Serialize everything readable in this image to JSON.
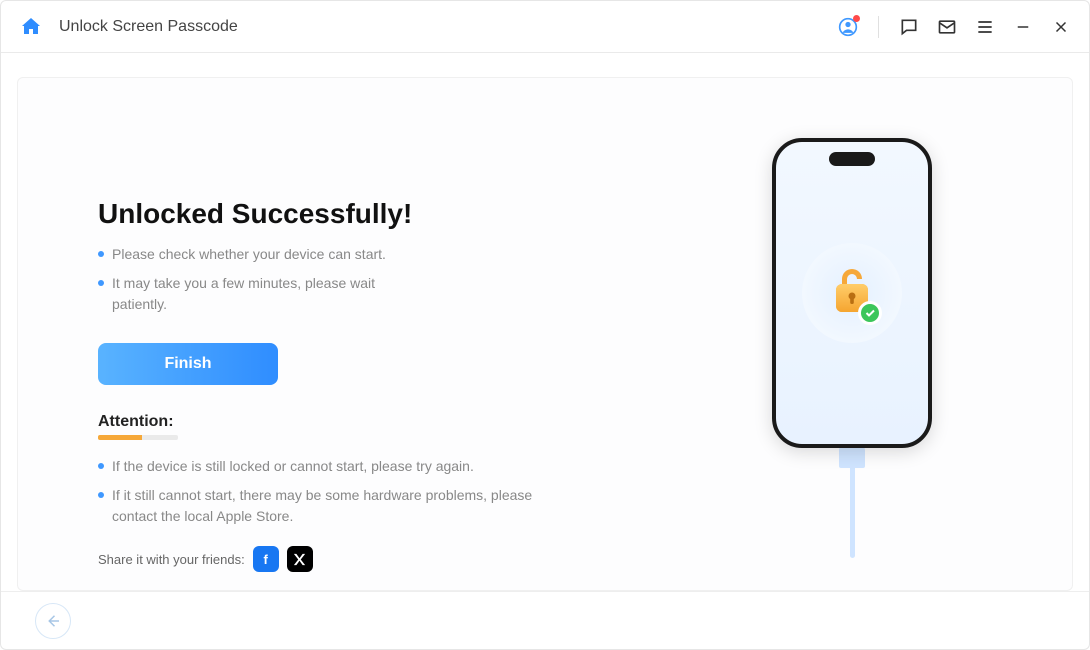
{
  "header": {
    "title": "Unlock Screen Passcode"
  },
  "main": {
    "heading": "Unlocked Successfully!",
    "notes": [
      "Please check whether your device can start.",
      "It may take you a few minutes, please wait patiently."
    ],
    "finish_label": "Finish",
    "attention_heading": "Attention:",
    "attention_items": [
      "If the device is still locked or cannot start, please try again.",
      "If it still cannot start, there may be some hardware problems, please contact the local Apple Store."
    ],
    "share_label": "Share it with your friends:"
  }
}
